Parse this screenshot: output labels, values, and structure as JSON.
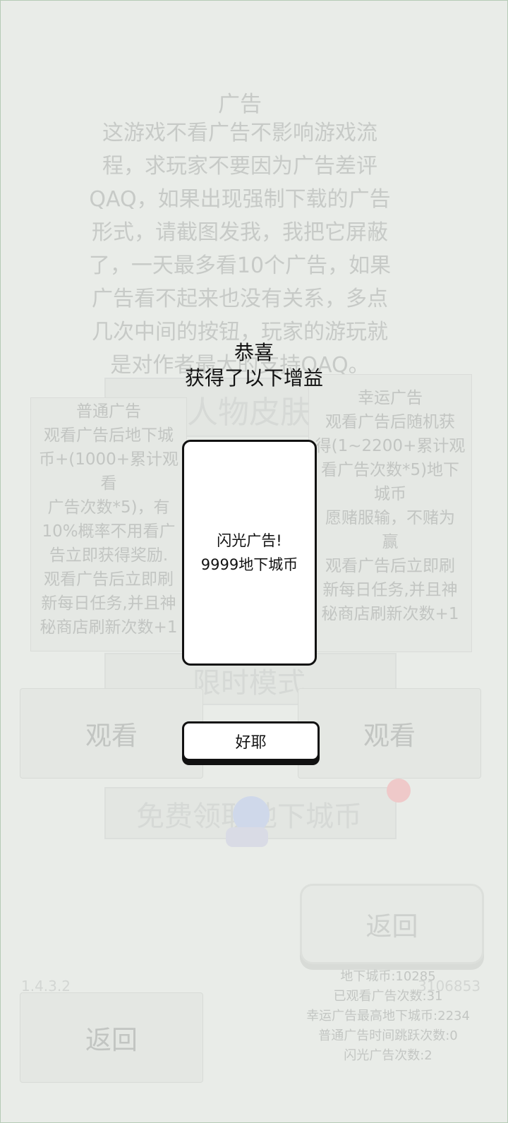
{
  "background": {
    "ad_notice": {
      "title": "广告",
      "lines": [
        "这游戏不看广告不影响游戏流",
        "程，求玩家不要因为广告差评",
        "QAQ，如果出现强制下载的广告",
        "形式，请截图发我，我把它屏蔽",
        "了，一天最多看10个广告，如果",
        "广告看不起来也没有关系，多点",
        "几次中间的按钮，玩家的游玩就",
        "是对作者最大的支持QAQ。"
      ]
    },
    "menu_items": [
      "人物皮肤",
      "限时模式",
      "免费领取地下城币"
    ],
    "normal_ad": {
      "title": "普通广告",
      "lines": [
        "观看广告后地下城",
        "币+(1000+累计观看",
        "广告次数*5)，有",
        "10%概率不用看广",
        "告立即获得奖励.",
        "观看广告后立即刷",
        "新每日任务,并且神",
        "秘商店刷新次数+1"
      ],
      "button": "观看"
    },
    "lucky_ad": {
      "title": "幸运广告",
      "lines": [
        "观看广告后随机获",
        "得(1~2200+累计观",
        "看广告次数*5)地下",
        "城币",
        "愿赌服输，不赌为",
        "赢",
        "观看广告后立即刷",
        "新每日任务,并且神",
        "秘商店刷新次数+1"
      ],
      "button": "观看"
    },
    "back_left": "返回",
    "back_right": "返回",
    "version": "1.4.3.2",
    "user_id": "3106853",
    "stats": [
      "地下城币:10285",
      "已观看广告次数:31",
      "幸运广告最高地下城币:2234",
      "普通广告时间跳跃次数:0",
      "闪光广告次数:2"
    ]
  },
  "popup": {
    "title": "恭喜",
    "subtitle": "获得了以下增益",
    "card_line1": "闪光广告!",
    "card_line2": "9999地下城币",
    "ok_button": "好耶"
  }
}
